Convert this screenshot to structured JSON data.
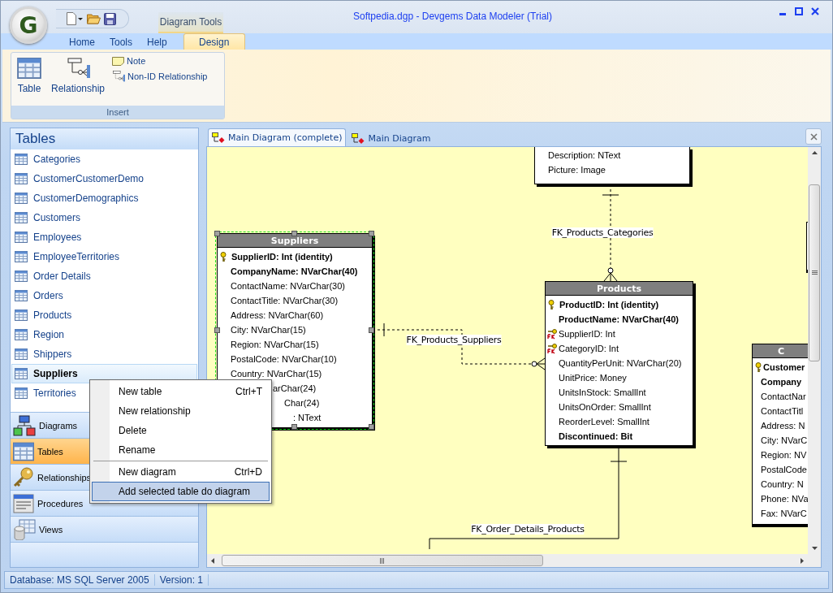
{
  "app_button": {
    "label": "G"
  },
  "window": {
    "title": "Softpedia.dgp - Devgems Data Modeler (Trial)"
  },
  "contextual_tab_group": {
    "label": "Diagram Tools"
  },
  "ribbon_tabs": [
    {
      "label": "Home",
      "selected": false
    },
    {
      "label": "Tools",
      "selected": false
    },
    {
      "label": "Help",
      "selected": false
    },
    {
      "label": "Design",
      "selected": true
    }
  ],
  "ribbon_group": {
    "label": "Insert",
    "large_buttons": [
      {
        "label": "Table",
        "kind": "table"
      },
      {
        "label": "Relationship",
        "kind": "relationship"
      }
    ],
    "small_buttons": [
      {
        "label": "Note",
        "kind": "note"
      },
      {
        "label": "Non-ID Relationship",
        "kind": "relationship"
      }
    ]
  },
  "sidebar": {
    "title": "Tables",
    "items": [
      {
        "label": "Categories",
        "selected": false
      },
      {
        "label": "CustomerCustomerDemo",
        "selected": false
      },
      {
        "label": "CustomerDemographics",
        "selected": false
      },
      {
        "label": "Customers",
        "selected": false
      },
      {
        "label": "Employees",
        "selected": false
      },
      {
        "label": "EmployeeTerritories",
        "selected": false
      },
      {
        "label": "Order Details",
        "selected": false
      },
      {
        "label": "Orders",
        "selected": false
      },
      {
        "label": "Products",
        "selected": false
      },
      {
        "label": "Region",
        "selected": false
      },
      {
        "label": "Shippers",
        "selected": false
      },
      {
        "label": "Suppliers",
        "selected": true
      },
      {
        "label": "Territories",
        "selected": false
      }
    ],
    "nav": [
      {
        "label": "Diagrams",
        "kind": "diagrams",
        "selected": false
      },
      {
        "label": "Tables",
        "kind": "tables",
        "selected": true
      },
      {
        "label": "Relationships",
        "kind": "relationships",
        "selected": false
      },
      {
        "label": "Procedures",
        "kind": "procedures",
        "selected": false
      },
      {
        "label": "Views",
        "kind": "views",
        "selected": false
      }
    ]
  },
  "document_tabs": [
    {
      "label": "Main Diagram (complete)",
      "selected": true
    },
    {
      "label": "Main Diagram",
      "selected": false
    }
  ],
  "diagram": {
    "tables": [
      {
        "kind": "cut-top",
        "selected": false,
        "columns": [
          {
            "text": "Description: NText",
            "kind": "plain",
            "bold": false
          },
          {
            "text": "Picture: Image",
            "kind": "plain",
            "bold": false
          }
        ]
      },
      {
        "kind": "full",
        "name": "Suppliers",
        "selected": true,
        "columns": [
          {
            "text": "SupplierID: Int (identity)",
            "kind": "pk",
            "bold": true
          },
          {
            "text": "CompanyName: NVarChar(40)",
            "kind": "plain",
            "bold": true
          },
          {
            "text": "ContactName: NVarChar(30)",
            "kind": "plain",
            "bold": false
          },
          {
            "text": "ContactTitle: NVarChar(30)",
            "kind": "plain",
            "bold": false
          },
          {
            "text": "Address: NVarChar(60)",
            "kind": "plain",
            "bold": false
          },
          {
            "text": "City: NVarChar(15)",
            "kind": "plain",
            "bold": false
          },
          {
            "text": "Region: NVarChar(15)",
            "kind": "plain",
            "bold": false
          },
          {
            "text": "PostalCode: NVarChar(10)",
            "kind": "plain",
            "bold": false
          },
          {
            "text": "Country: NVarChar(15)",
            "kind": "plain",
            "bold": false
          },
          {
            "text": "arChar(24)",
            "kind": "covered",
            "bold": false
          },
          {
            "text": "Char(24)",
            "kind": "covered-more",
            "bold": false
          },
          {
            "text": ": NText",
            "kind": "covered-most",
            "bold": false
          }
        ]
      },
      {
        "kind": "full",
        "name": "Products",
        "selected": false,
        "columns": [
          {
            "text": "ProductID: Int (identity)",
            "kind": "pk",
            "bold": true
          },
          {
            "text": "ProductName: NVarChar(40)",
            "kind": "plain",
            "bold": true
          },
          {
            "text": "SupplierID: Int",
            "kind": "fk",
            "bold": false
          },
          {
            "text": "CategoryID: Int",
            "kind": "fk",
            "bold": false
          },
          {
            "text": "QuantityPerUnit: NVarChar(20)",
            "kind": "plain",
            "bold": false
          },
          {
            "text": "UnitPrice: Money",
            "kind": "plain",
            "bold": false
          },
          {
            "text": "UnitsInStock: SmallInt",
            "kind": "plain",
            "bold": false
          },
          {
            "text": "UnitsOnOrder: SmallInt",
            "kind": "plain",
            "bold": false
          },
          {
            "text": "ReorderLevel: SmallInt",
            "kind": "plain",
            "bold": false
          },
          {
            "text": "Discontinued: Bit",
            "kind": "plain",
            "bold": true
          }
        ]
      },
      {
        "kind": "cut-right",
        "name": "C",
        "selected": false,
        "columns": [
          {
            "text": "Customer",
            "kind": "pk",
            "bold": true
          },
          {
            "text": "Company",
            "kind": "plain",
            "bold": true
          },
          {
            "text": "ContactNar",
            "kind": "plain",
            "bold": false
          },
          {
            "text": "ContactTitl",
            "kind": "plain",
            "bold": false
          },
          {
            "text": "Address: N",
            "kind": "plain",
            "bold": false
          },
          {
            "text": "City: NVarC",
            "kind": "plain",
            "bold": false
          },
          {
            "text": "Region: NV",
            "kind": "plain",
            "bold": false
          },
          {
            "text": "PostalCode",
            "kind": "plain",
            "bold": false
          },
          {
            "text": "Country: N",
            "kind": "plain",
            "bold": false
          },
          {
            "text": "Phone: NVa",
            "kind": "plain",
            "bold": false
          },
          {
            "text": "Fax: NVarC",
            "kind": "plain",
            "bold": false
          }
        ]
      }
    ],
    "relationships": [
      {
        "label": "FK_Products_Categories",
        "kind": "dashed"
      },
      {
        "label": "FK_Products_Suppliers",
        "kind": "dashed"
      },
      {
        "label": "FK_Order_Details_Products",
        "kind": "solid"
      }
    ]
  },
  "context_menu": {
    "items": [
      {
        "kind": "item",
        "label": "New table",
        "shortcut": "Ctrl+T",
        "selected": false
      },
      {
        "kind": "item",
        "label": "New relationship",
        "selected": false
      },
      {
        "kind": "item",
        "label": "Delete",
        "selected": false
      },
      {
        "kind": "item",
        "label": "Rename",
        "selected": false
      },
      {
        "kind": "separator"
      },
      {
        "kind": "item",
        "label": "New diagram",
        "shortcut": "Ctrl+D",
        "selected": false
      },
      {
        "kind": "item",
        "label": "Add selected table do diagram",
        "selected": true
      }
    ]
  },
  "status_bar": [
    "Database: MS SQL Server 2005",
    "Version: 1"
  ]
}
